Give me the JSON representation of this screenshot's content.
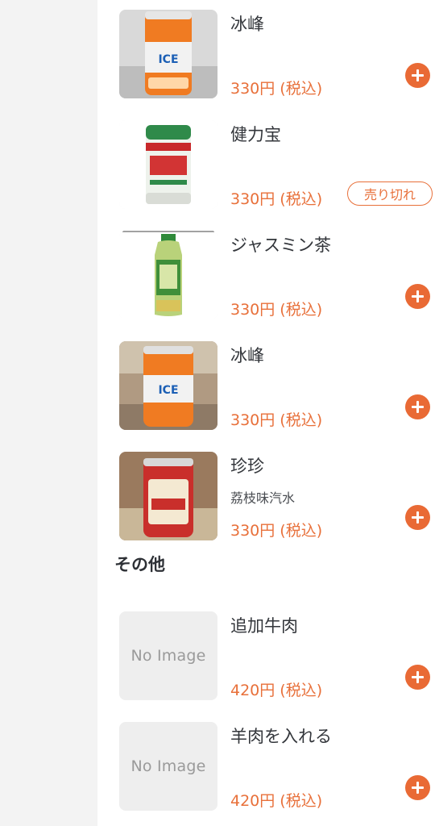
{
  "colors": {
    "accent": "#e96a35",
    "price": "#e8703a",
    "text": "#33363b",
    "sidebar_bg": "#f3f3f3"
  },
  "items": [
    {
      "name": "冰峰",
      "subtitle": "",
      "price": "330円 (税込)",
      "image": "can-orange",
      "action": "add"
    },
    {
      "name": "健力宝",
      "subtitle": "",
      "price": "330円 (税込)",
      "image": "can-white",
      "action": "sold-out",
      "badge": "売り切れ"
    },
    {
      "name": "ジャスミン茶",
      "subtitle": "",
      "price": "330円 (税込)",
      "image": "bottle-green",
      "action": "add"
    },
    {
      "name": "冰峰",
      "subtitle": "",
      "price": "330円 (税込)",
      "image": "can-orange",
      "action": "add"
    },
    {
      "name": "珍珍",
      "subtitle": "荔枝味汽水",
      "price": "330円 (税込)",
      "image": "can-red",
      "action": "add"
    }
  ],
  "section": {
    "title": "その他"
  },
  "other_items": [
    {
      "name": "追加牛肉",
      "price": "420円 (税込)",
      "image_placeholder": "No Image",
      "action": "add"
    },
    {
      "name": "羊肉を入れる",
      "price": "420円 (税込)",
      "image_placeholder": "No Image",
      "action": "add"
    }
  ],
  "icons": {
    "add": "plus-circle-icon"
  }
}
